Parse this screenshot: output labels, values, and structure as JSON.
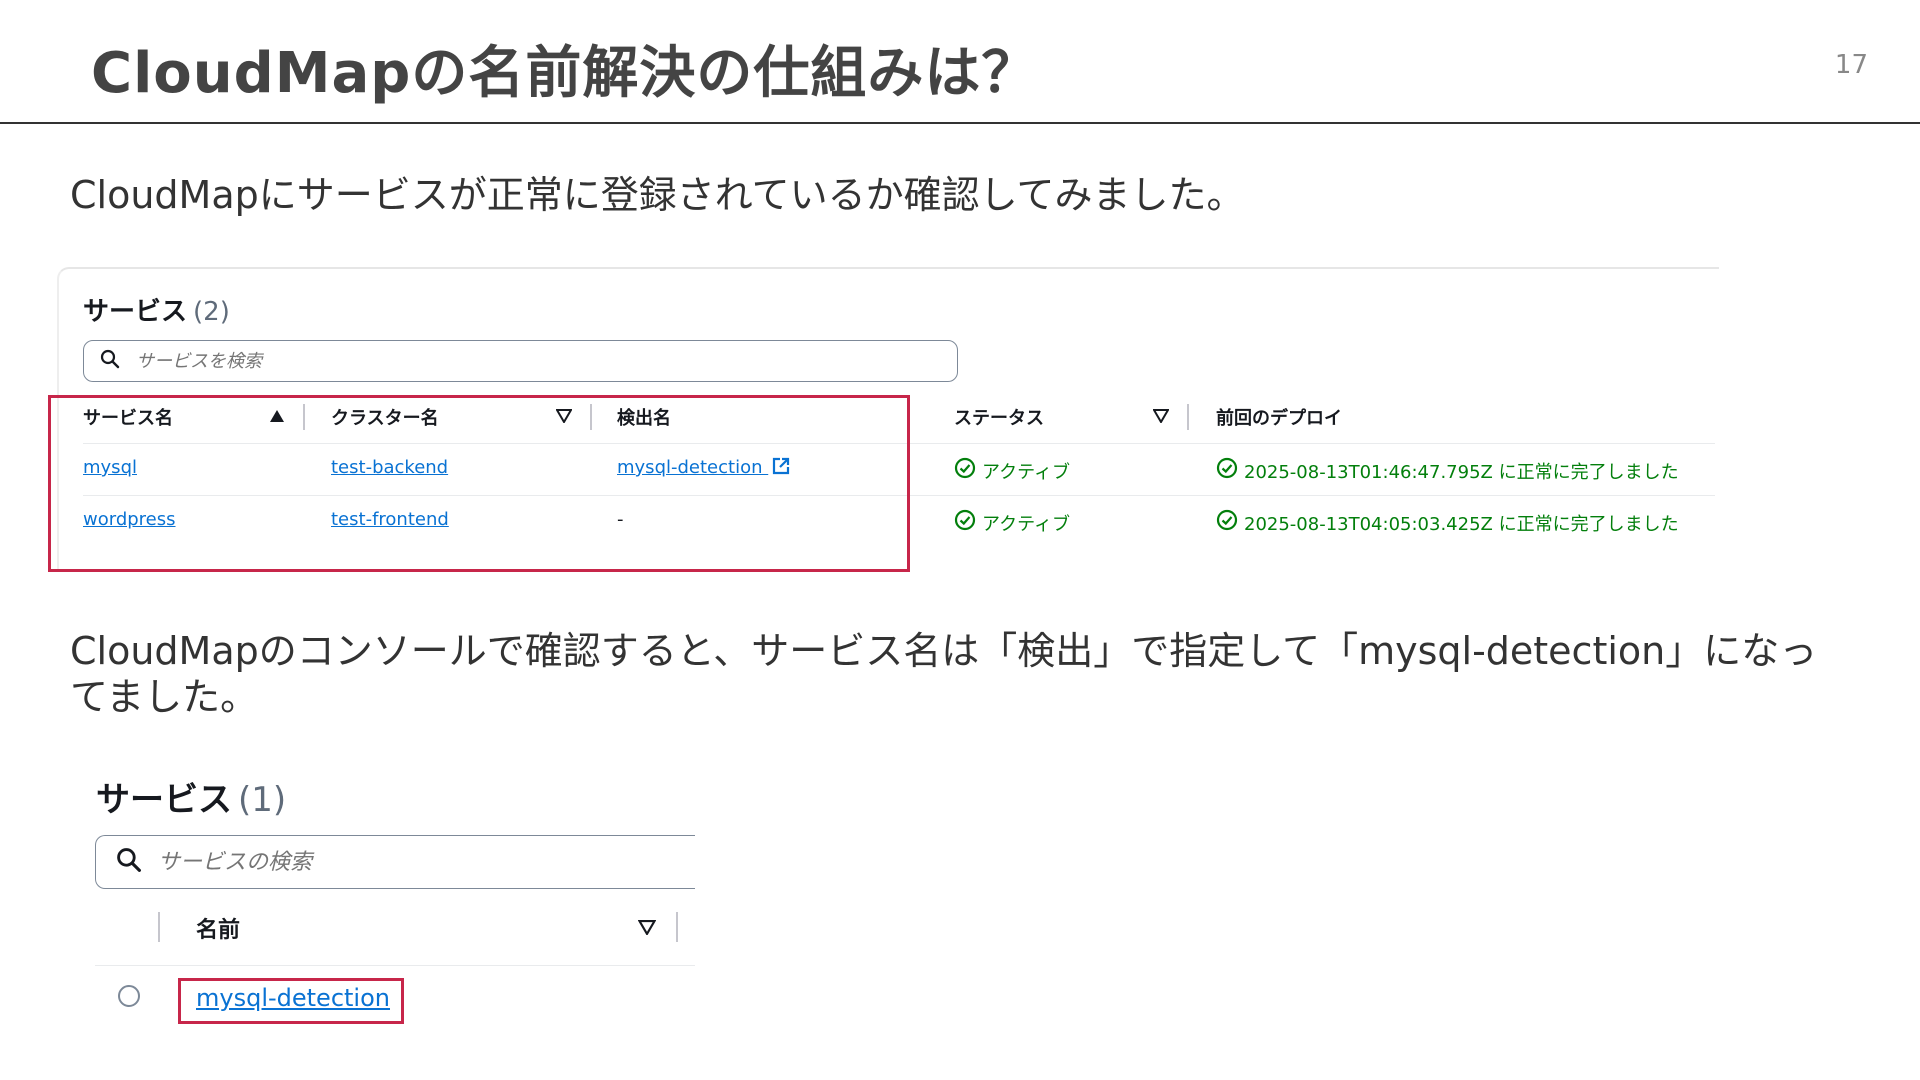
{
  "slide": {
    "title": "CloudMapの名前解決の仕組みは？",
    "page_number": "17",
    "paragraph1": "CloudMapにサービスが正常に登録されているか確認してみました。",
    "paragraph2": "CloudMapのコンソールで確認すると、サービス名は「検出」で指定して「mysql-detection」になってました。"
  },
  "panel1": {
    "heading": "サービス",
    "count": "(2)",
    "search": {
      "placeholder": "サービスを検索",
      "value": ""
    },
    "columns": {
      "service_name": "サービス名",
      "cluster_name": "クラスター名",
      "discovery_name": "検出名",
      "status": "ステータス",
      "last_deploy": "前回のデプロイ"
    },
    "rows": [
      {
        "service": "mysql",
        "cluster": "test-backend",
        "discovery": "mysql-detection",
        "status": "アクティブ",
        "last_deploy": "2025-08-13T01:46:47.795Z に正常に完了しました"
      },
      {
        "service": "wordpress",
        "cluster": "test-frontend",
        "discovery": "-",
        "status": "アクティブ",
        "last_deploy": "2025-08-13T04:05:03.425Z に正常に完了しました"
      }
    ]
  },
  "panel2": {
    "heading": "サービス",
    "count": "(1)",
    "search": {
      "placeholder": "サービスの検索",
      "value": ""
    },
    "column_name": "名前",
    "row_link": "mysql-detection"
  },
  "colors": {
    "link": "#0972d3",
    "success": "#037f0c",
    "highlight": "#c7264a",
    "title": "#444444"
  }
}
